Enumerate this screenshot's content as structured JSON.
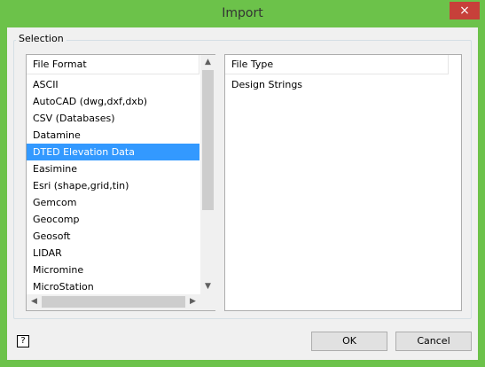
{
  "window": {
    "title": "Import",
    "close_icon": "×"
  },
  "group": {
    "title": "Selection"
  },
  "file_format": {
    "header": "File Format",
    "items": [
      "ASCII",
      "AutoCAD (dwg,dxf,dxb)",
      "CSV (Databases)",
      "Datamine",
      "DTED Elevation Data",
      "Easimine",
      "Esri (shape,grid,tin)",
      "Gemcom",
      "Geocomp",
      "Geosoft",
      "LIDAR",
      "Micromine",
      "MicroStation"
    ],
    "selected_index": 4
  },
  "file_type": {
    "header": "File Type",
    "items": [
      "Design Strings"
    ]
  },
  "buttons": {
    "ok": "OK",
    "cancel": "Cancel"
  },
  "help": {
    "icon": "?"
  },
  "scroll": {
    "up": "▲",
    "down": "▼",
    "left": "◀",
    "right": "▶"
  }
}
